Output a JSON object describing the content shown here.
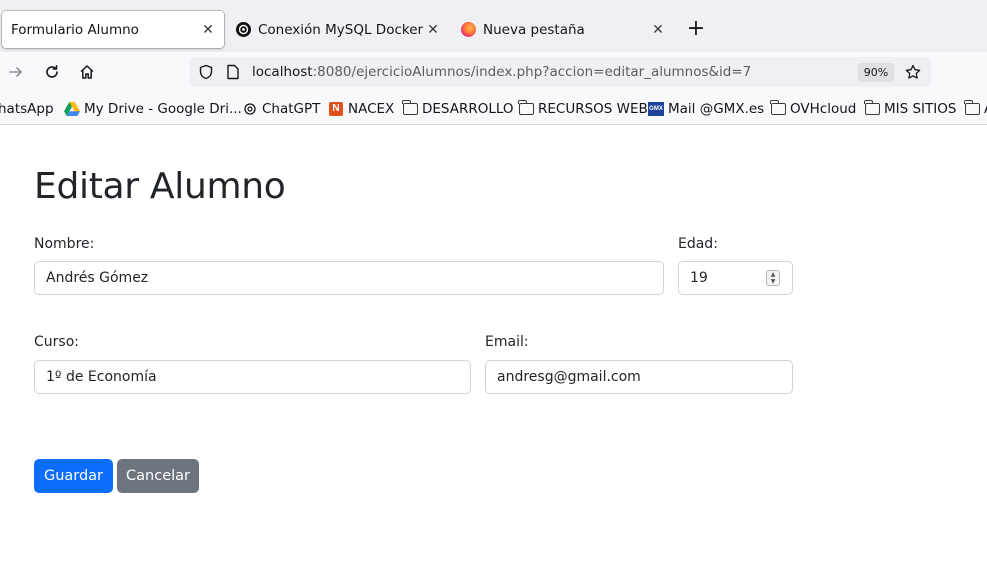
{
  "tabs": [
    {
      "title": "Formulario Alumno",
      "active": true,
      "icon": "none"
    },
    {
      "title": "Conexión MySQL Docker",
      "active": false,
      "icon": "openai-icon"
    },
    {
      "title": "Nueva pestaña",
      "active": false,
      "icon": "firefox-icon"
    }
  ],
  "tab_close_glyph": "✕",
  "new_tab_glyph": "+",
  "url": {
    "host": "localhost",
    "rest": ":8080/ejercicioAlumnos/index.php?accion=editar_alumnos&id=7"
  },
  "zoom": "90%",
  "bookmarks": [
    {
      "label": "hatsApp",
      "icon": "whatsapp-icon"
    },
    {
      "label": "My Drive - Google Dri...",
      "icon": "google-drive-icon"
    },
    {
      "label": "ChatGPT",
      "icon": "openai-icon"
    },
    {
      "label": "NACEX",
      "icon": "nacex-icon"
    },
    {
      "label": "DESARROLLO",
      "icon": "folder-icon"
    },
    {
      "label": "RECURSOS WEB",
      "icon": "folder-icon"
    },
    {
      "label": "Mail @GMX.es",
      "icon": "gmx-icon"
    },
    {
      "label": "OVHcloud",
      "icon": "folder-icon"
    },
    {
      "label": "MIS SITIOS",
      "icon": "folder-icon"
    },
    {
      "label": "A",
      "icon": "folder-icon"
    }
  ],
  "form": {
    "title": "Editar Alumno",
    "nombre_label": "Nombre:",
    "nombre_value": "Andrés Gómez",
    "edad_label": "Edad:",
    "edad_value": "19",
    "curso_label": "Curso:",
    "curso_value": "1º de Economía",
    "email_label": "Email:",
    "email_value": "andresg@gmail.com",
    "save_label": "Guardar",
    "cancel_label": "Cancelar"
  },
  "colors": {
    "primary": "#0d6efd",
    "secondary": "#6c757d",
    "text": "#212529"
  }
}
